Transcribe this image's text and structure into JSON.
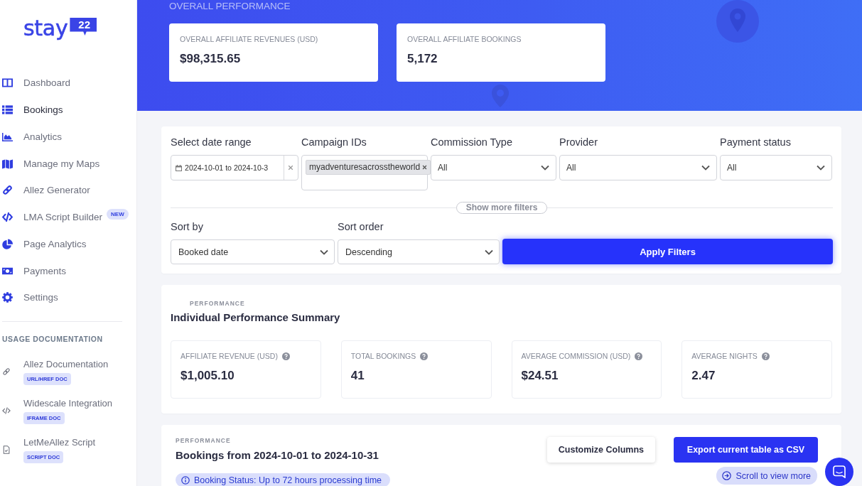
{
  "sidebar": {
    "logo": {
      "text": "stay",
      "badge": "22"
    },
    "items": [
      {
        "label": "Dashboard",
        "selected": false
      },
      {
        "label": "Bookings",
        "selected": true
      },
      {
        "label": "Analytics",
        "selected": false
      },
      {
        "label": "Manage my Maps",
        "selected": false
      },
      {
        "label": "Allez Generator",
        "selected": false
      },
      {
        "label": "LMA Script Builder",
        "selected": false,
        "badge": "NEW"
      },
      {
        "label": "Page Analytics",
        "selected": false
      },
      {
        "label": "Payments",
        "selected": false
      },
      {
        "label": "Settings",
        "selected": false
      }
    ],
    "sections": [
      {
        "title": "USAGE DOCUMENTATION",
        "items": [
          {
            "label": "Allez Documentation",
            "tag": "URL/HREF DOC"
          },
          {
            "label": "Widescale Integration",
            "tag": "IFRAME DOC"
          },
          {
            "label": "LetMeAllez Script",
            "tag": "SCRIPT DOC"
          }
        ]
      }
    ]
  },
  "overall_performance": {
    "title": "OVERALL PERFORMANCE",
    "cards": [
      {
        "label": "OVERALL AFFILIATE REVENUES (USD)",
        "value": "$98,315.65"
      },
      {
        "label": "OVERALL AFFILIATE BOOKINGS",
        "value": "5,172"
      }
    ]
  },
  "filters": {
    "fields": [
      {
        "kind": "date",
        "label": "Select date range",
        "value": "2024-10-01 to 2024-10-3"
      },
      {
        "kind": "tags",
        "label": "Campaign IDs",
        "tags": [
          "myadventuresacrosstheworld"
        ]
      },
      {
        "kind": "select",
        "label": "Commission Type",
        "value": "All"
      },
      {
        "kind": "select",
        "label": "Provider",
        "value": "All"
      },
      {
        "kind": "select",
        "label": "Payment status",
        "value": "All"
      }
    ],
    "more_button": "Show more filters",
    "sort": [
      {
        "label": "Sort by",
        "value": "Booked date"
      },
      {
        "label": "Sort order",
        "value": "Descending"
      }
    ],
    "apply_button": "Apply Filters"
  },
  "summary": {
    "eyebrow": "PERFORMANCE",
    "title": "Individual Performance Summary",
    "metrics": [
      {
        "label": "AFFILIATE REVENUE (USD)",
        "value": "$1,005.10"
      },
      {
        "label": "TOTAL BOOKINGS",
        "value": "41"
      },
      {
        "label": "AVERAGE COMMISSION (USD)",
        "value": "$24.51"
      },
      {
        "label": "AVERAGE NIGHTS",
        "value": "2.47"
      }
    ]
  },
  "bookings": {
    "eyebrow": "PERFORMANCE",
    "title": "Bookings from 2024-10-01 to 2024-10-31",
    "status_note": "Booking Status: Up to 72 hours processing time",
    "buttons": [
      {
        "kind": "secondary",
        "label": "Customize Columns"
      },
      {
        "kind": "primary",
        "label": "Export current table as CSV"
      }
    ],
    "scroll_hint": "Scroll to view more"
  }
}
